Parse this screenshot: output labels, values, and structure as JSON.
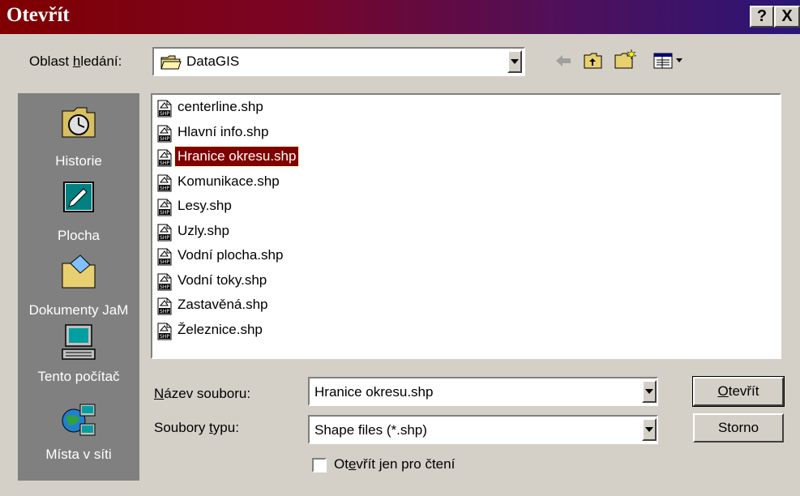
{
  "window": {
    "title": "Otevřít",
    "help_label": "?",
    "close_label": "X"
  },
  "toolbar": {
    "look_in_label_pre": "Oblast ",
    "look_in_label_key": "h",
    "look_in_label_post": "ledání:",
    "look_in_value": "DataGIS"
  },
  "places": [
    {
      "label": "Historie",
      "icon": "history-icon"
    },
    {
      "label": "Plocha",
      "icon": "desktop-icon"
    },
    {
      "label": "Dokumenty JaM",
      "icon": "my-documents-icon"
    },
    {
      "label": "Tento počítač",
      "icon": "my-computer-icon"
    },
    {
      "label": "Místa v síti",
      "icon": "network-places-icon"
    }
  ],
  "files": [
    {
      "name": "centerline.shp",
      "selected": false
    },
    {
      "name": "Hlavní info.shp",
      "selected": false
    },
    {
      "name": "Hranice okresu.shp",
      "selected": true
    },
    {
      "name": "Komunikace.shp",
      "selected": false
    },
    {
      "name": "Lesy.shp",
      "selected": false
    },
    {
      "name": "Uzly.shp",
      "selected": false
    },
    {
      "name": "Vodní plocha.shp",
      "selected": false
    },
    {
      "name": "Vodní toky.shp",
      "selected": false
    },
    {
      "name": "Zastavěná.shp",
      "selected": false
    },
    {
      "name": "Železnice.shp",
      "selected": false
    }
  ],
  "filename": {
    "label_key": "N",
    "label_rest": "ázev souboru:",
    "value": "Hranice okresu.shp"
  },
  "filetype": {
    "label_pre": "Soubory ",
    "label_key": "t",
    "label_rest": "ypu:",
    "value": "Shape files (*.shp)"
  },
  "readonly": {
    "label_pre": "Ot",
    "label_key": "e",
    "label_rest": "vřít jen pro čtení",
    "checked": false
  },
  "buttons": {
    "open_key": "O",
    "open_rest": "tevřít",
    "cancel": "Storno"
  },
  "colors": {
    "selection": "#800000",
    "dialog_bg": "#d4d0c8",
    "places_bar": "#808080"
  }
}
